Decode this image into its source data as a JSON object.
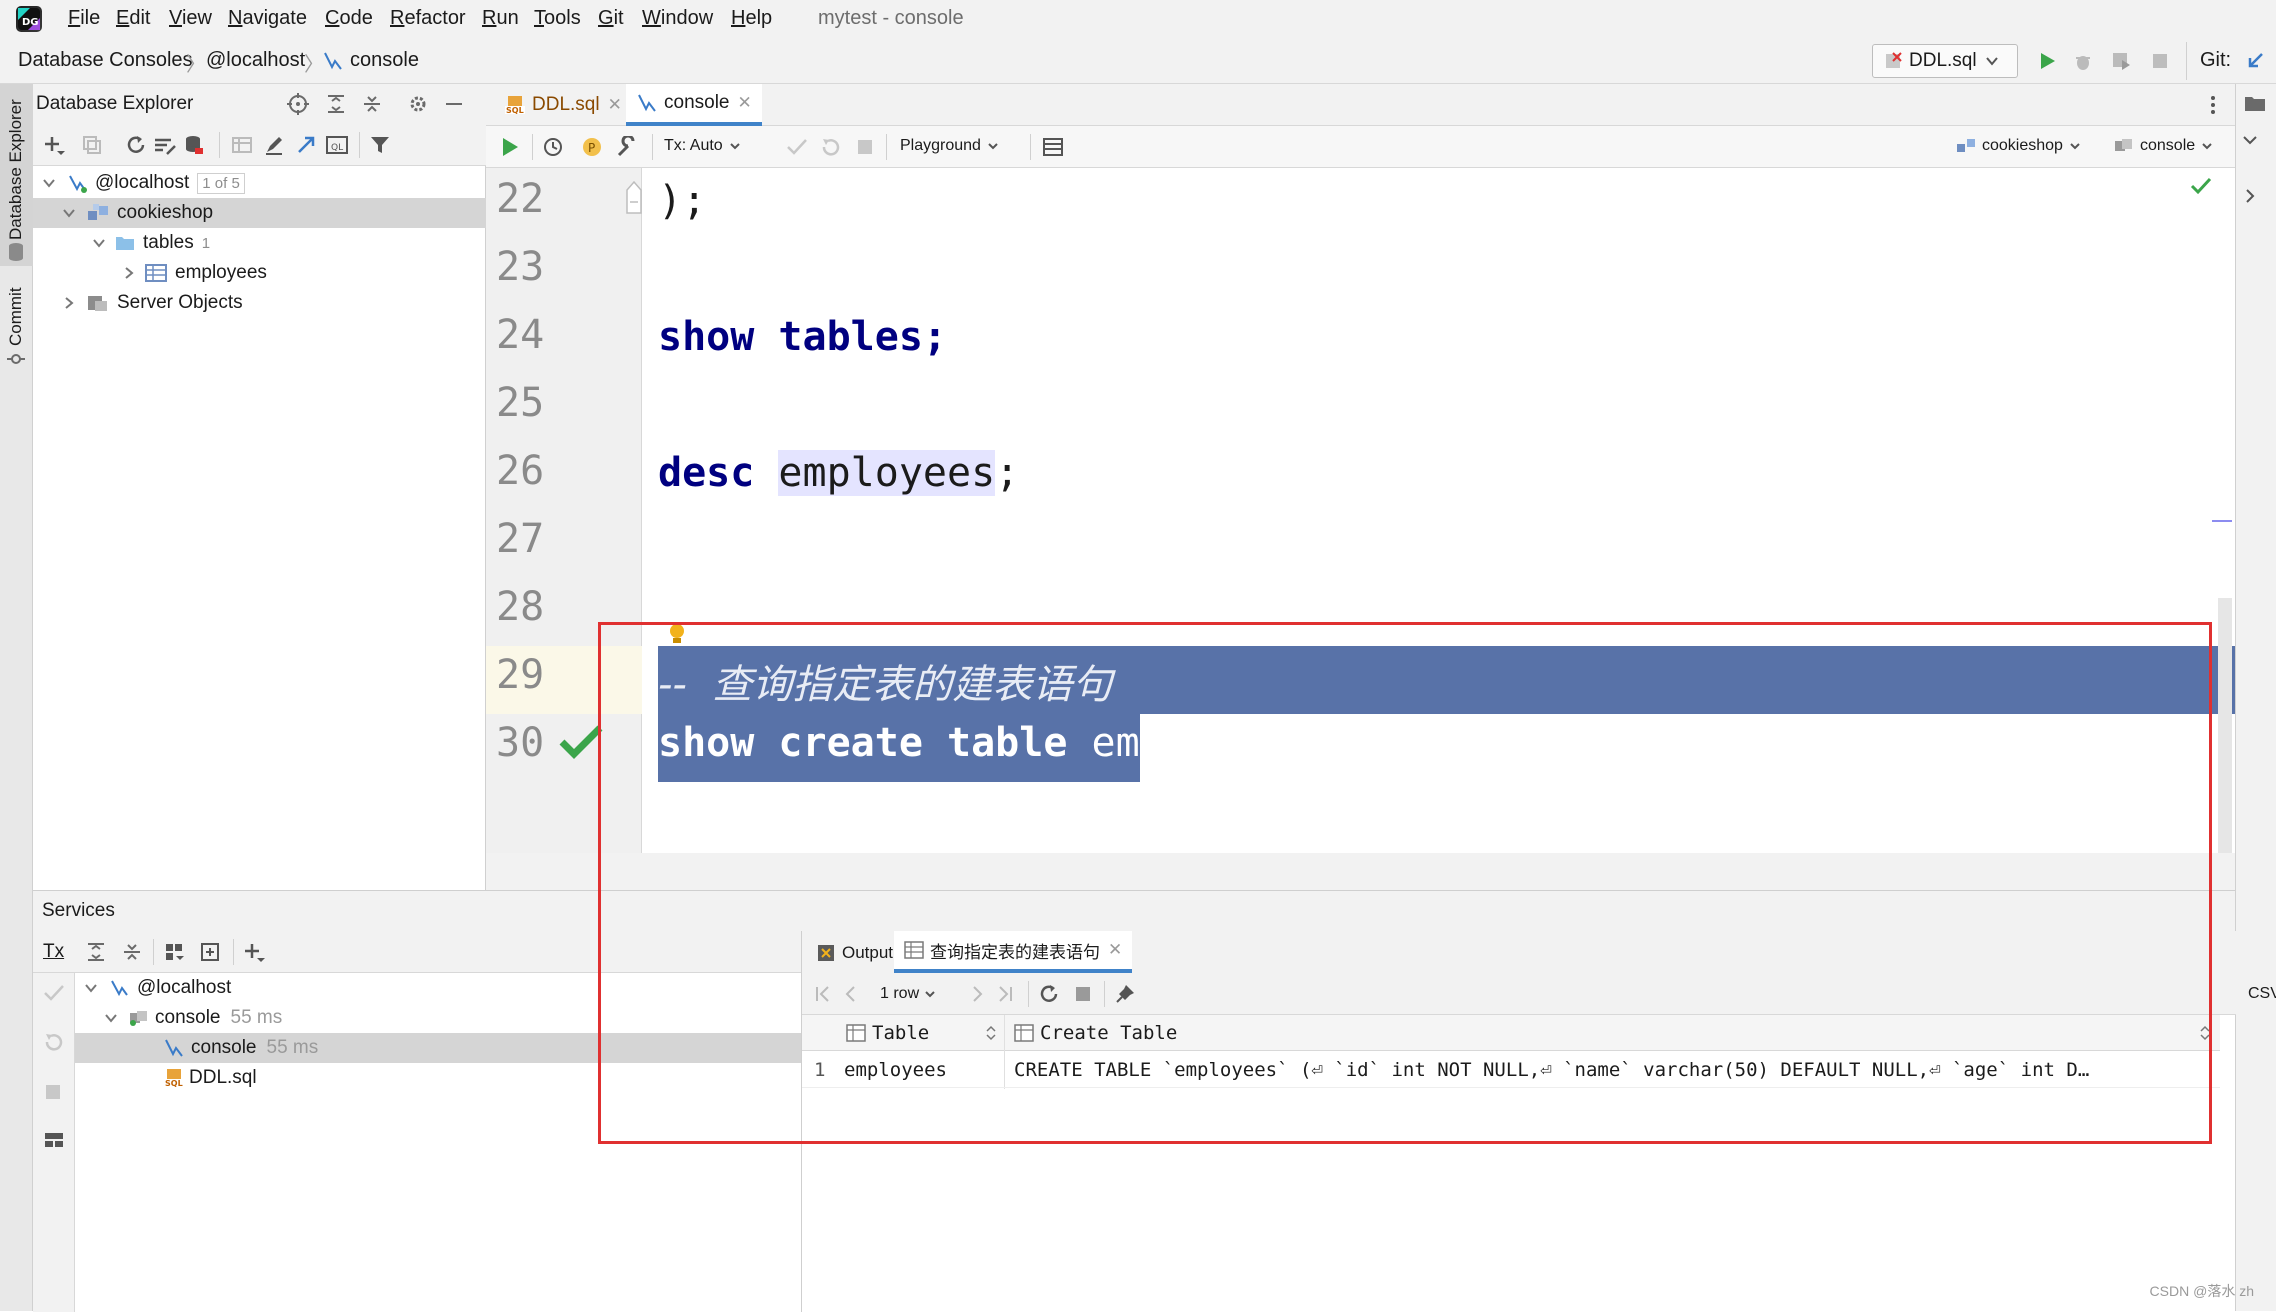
{
  "menubar": {
    "items": [
      {
        "label": "File",
        "mnemonic": "F",
        "rest": "ile"
      },
      {
        "label": "Edit",
        "mnemonic": "E",
        "rest": "dit"
      },
      {
        "label": "View",
        "mnemonic": "V",
        "rest": "iew"
      },
      {
        "label": "Navigate",
        "mnemonic": "N",
        "rest": "avigate"
      },
      {
        "label": "Code",
        "mnemonic": "C",
        "rest": "ode"
      },
      {
        "label": "Refactor",
        "mnemonic": "R",
        "rest": "efactor"
      },
      {
        "label": "Run",
        "mnemonic": "R",
        "rest": "un"
      },
      {
        "label": "Tools",
        "mnemonic": "T",
        "rest": "ools"
      },
      {
        "label": "Git",
        "mnemonic": "G",
        "rest": "it"
      },
      {
        "label": "Window",
        "mnemonic": "W",
        "rest": "indow"
      },
      {
        "label": "Help",
        "mnemonic": "H",
        "rest": "elp"
      }
    ],
    "window_title": "mytest - console"
  },
  "navbar": {
    "breadcrumb": [
      "Database Consoles",
      "@localhost",
      "console"
    ],
    "run_config": "DDL.sql",
    "git_label": "Git:"
  },
  "leftstrip": {
    "database_explorer": "Database Explorer",
    "commit": "Commit"
  },
  "db_explorer": {
    "title": "Database Explorer",
    "tree": {
      "host": "@localhost",
      "host_badge": "1 of 5",
      "schema": "cookieshop",
      "tables_label": "tables",
      "tables_count": "1",
      "table": "employees",
      "server_objects": "Server Objects"
    }
  },
  "editor": {
    "tabs": [
      {
        "label": "DDL.sql"
      },
      {
        "label": "console"
      }
    ],
    "toolbar": {
      "tx_mode": "Tx: Auto",
      "playground": "Playground",
      "schema": "cookieshop",
      "session": "console"
    },
    "line_numbers": [
      "22",
      "23",
      "24",
      "25",
      "26",
      "27",
      "28",
      "29",
      "30"
    ],
    "code": {
      "line22": ");",
      "line24_kw": "show",
      "line24_rest": " tables;",
      "line26_kw": "desc",
      "line26_ident": "employees",
      "line26_end": ";",
      "line29_comment": "--  查询指定表的建表语句",
      "line30_kw": "show create table",
      "line30_ident": " employees",
      "line30_end": ";"
    },
    "accent_color": "#4083c9",
    "selection_color": "#5872a8"
  },
  "services": {
    "title": "Services",
    "tx_label": "Tx",
    "tree": {
      "host": "@localhost",
      "console_group": "console",
      "console_group_time": "55 ms",
      "console": "console",
      "console_time": "55 ms",
      "ddl": "DDL.sql"
    },
    "result_tabs": {
      "output": "Output",
      "query": "查询指定表的建表语句"
    },
    "result_toolbar": {
      "rows": "1 row",
      "export": "CSV"
    },
    "grid": {
      "headers": [
        "Table",
        "Create Table"
      ],
      "rows": [
        {
          "num": "1",
          "table": "employees",
          "create": "CREATE TABLE `employees` (⏎  `id` int NOT NULL,⏎  `name` varchar(50) DEFAULT NULL,⏎  `age` int D…"
        }
      ]
    }
  },
  "watermark": "CSDN @落水 zh"
}
